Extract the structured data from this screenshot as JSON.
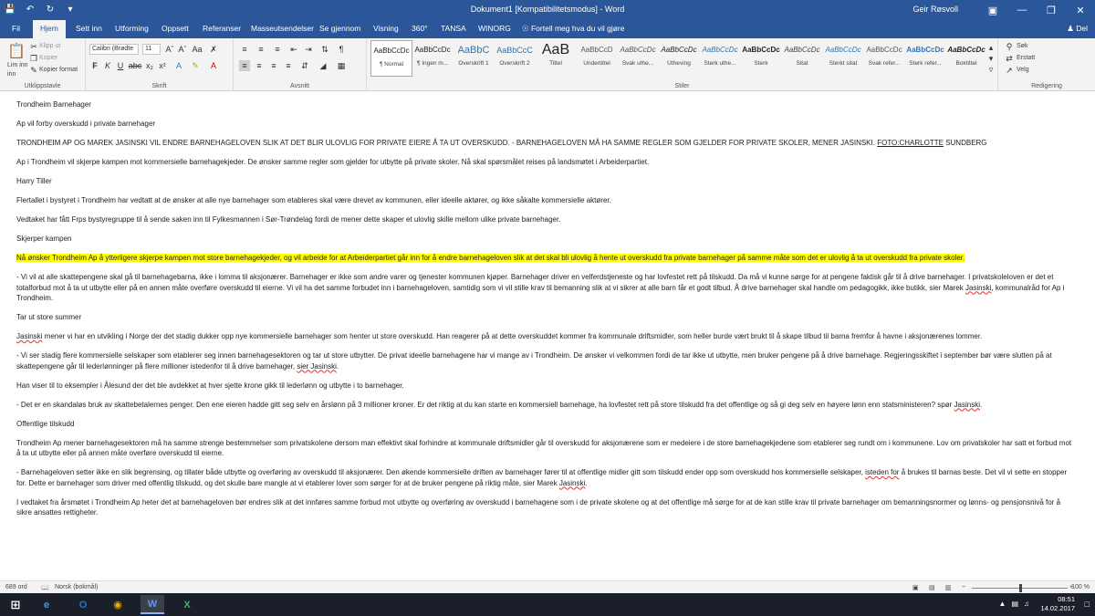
{
  "titlebar": {
    "doc_title": "Dokument1 [Kompatibilitetsmodus] - Word",
    "user": "Geir Røsvoll"
  },
  "tabs": {
    "file": "Fil",
    "home": "Hjem",
    "insert": "Sett inn",
    "design": "Utforming",
    "layout": "Oppsett",
    "references": "Referanser",
    "mailings": "Masseutsendelser",
    "review": "Se gjennom",
    "view": "Visning",
    "t360": "360°",
    "tansa": "TANSA",
    "winorg": "WINORG",
    "tellme": "Fortell meg hva du vil gjøre",
    "share": "Del"
  },
  "ribbon": {
    "clipboard": {
      "paste": "Lim inn",
      "cut": "Klipp ut",
      "copy": "Kopier",
      "format_painter": "Kopier format",
      "label": "Utklippstavle"
    },
    "font": {
      "name": "Calibri (Brødte",
      "size": "11",
      "label": "Skrift"
    },
    "paragraph": {
      "label": "Avsnitt"
    },
    "styles": {
      "label": "Stiler",
      "items": [
        {
          "sample": "AaBbCcDc",
          "name": "¶ Normal"
        },
        {
          "sample": "AaBbCcDc",
          "name": "¶ Ingen m..."
        },
        {
          "sample": "AaBbC",
          "name": "Overskrift 1"
        },
        {
          "sample": "AaBbCcC",
          "name": "Overskrift 2"
        },
        {
          "sample": "AaB",
          "name": "Tittel"
        },
        {
          "sample": "AaBbCcD",
          "name": "Undertittel"
        },
        {
          "sample": "AaBbCcDc",
          "name": "Svak uthe..."
        },
        {
          "sample": "AaBbCcDc",
          "name": "Utheving"
        },
        {
          "sample": "AaBbCcDc",
          "name": "Sterk uthe..."
        },
        {
          "sample": "AaBbCcDc",
          "name": "Sterk"
        },
        {
          "sample": "AaBbCcDc",
          "name": "Sitat"
        },
        {
          "sample": "AaBbCcDc",
          "name": "Sterkt sitat"
        },
        {
          "sample": "AaBbCcDc",
          "name": "Svak refer..."
        },
        {
          "sample": "AaBbCcDc",
          "name": "Sterk refer..."
        },
        {
          "sample": "AaBbCcDc",
          "name": "Boktittel"
        }
      ]
    },
    "editing": {
      "find": "Søk",
      "replace": "Erstatt",
      "select": "Velg",
      "label": "Redigering"
    }
  },
  "document": {
    "p1": "Trondheim Barnehager",
    "p2": "Ap vil forby overskudd i private barnehager",
    "p3a": "TRONDHEIM AP OG MAREK JASINSKI VIL ENDRE BARNEHAGELOVEN SLIK AT DET BLIR ULOVLIG FOR PRIVATE EIERE Å TA UT OVERSKUDD. - BARNEHAGELOVEN MÅ HA SAMME REGLER SOM GJELDER FOR PRIVATE SKOLER, MENER JASINSKI.",
    "p3b": "FOTO:CHARLOTTE",
    "p3c": "SUNDBERG",
    "p4": "Ap i Trondheim vil skjerpe kampen mot kommersielle barnehagekjeder. De ønsker samme regler som gjelder for utbytte på private skoler. Nå skal spørsmålet reises på landsmøtet i Arbeiderpartiet.",
    "p5": "Harry Tiller",
    "p6": "Flertallet i bystyret i Trondheim har vedtatt at de ønsker at alle  nye barnehager som etableres skal være drevet av kommunen, eller ideelle aktører, og ikke såkalte kommersielle aktører.",
    "p7": "Vedtaket har fått Frps bystyregruppe til å sende saken inn til Fylkesmannen i Sør-Trøndelag fordi de mener dette skaper et ulovlig skille mellom ulike private barnehager.",
    "p8": "Skjerper kampen",
    "p9": "Nå ønsker Trondheim Ap å ytterligere skjerpe kampen mot store barnehagekjeder, og vil arbeide for at Arbeiderpartiet går inn for å endre barnehageloven slik at det skal bli ulovlig å hente ut overskudd fra private barnehager på samme måte som det er ulovlig å ta ut overskudd fra private skoler.",
    "p10a": "- Vi vil at alle skattepengene skal gå til barnehagebarna, ikke i lomma til  aksjonærer. Barnehager er ikke som andre varer og tjenester kommunen kjøper. Barnehager driver en velferdstjeneste og har lovfestet rett på tilskudd. Da må vi kunne sørge for at  pengene faktisk går til å drive barnehager. I privatskoleloven er det et totalforbud mot å ta ut utbytte eller på en annen måte overføre overskudd til eierne. Vi vil ha det samme forbudet inn i barnehageloven, samtidig som vi vil stille krav til bemanning slik at vi sikrer at alle barn får et godt tilbud. Å drive barnehager skal handle om pedagogikk, ikke butikk, sier Marek",
    "p10b": "Jasinski",
    "p10c": ", kommunalråd for Ap i Trondheim.",
    "p11": "Tar ut store summer",
    "p12a": "Jasinski",
    "p12b": " mener vi har en utvikling i  Norge der det stadig dukker opp nye kommersielle barnehager som henter ut store overskudd. Han reagerer på at  dette overskuddet kommer fra kommunale driftsmidler, som heller burde vært brukt til å skape tilbud til barna fremfor å havne i aksjonærenes lommer.",
    "p13a": "- Vi ser stadig flere kommersielle selskaper som etablerer seg innen barnehagesektoren og tar ut store utbytter. De privat ideelle barnehagene har vi mange av i Trondheim. De ønsker vi velkommen fordi de tar ikke ut utbytte, men bruker pengene på å drive barnehage. Regjeringsskiftet i september bør være slutten på at skattepengene går til lederlønninger på flere millioner istedenfor til å drive barnehager,",
    "p13b": "sier Jasinski",
    "p13c": ".",
    "p14": "Han viser til to eksempler i Ålesund der det ble avdekket at hver sjette krone gikk til  lederlønn og utbytte i  to barnehager.",
    "p15a": "- Det er en skandaløs bruk av skattebetalernes penger. Den ene eieren hadde gitt seg selv en årslønn på 3 millioner  kroner. Er det riktig at du kan starte en kommersiell barnehage, ha lovfestet rett på store tilskudd fra det offentlige og så gi deg selv en høyere lønn enn statsministeren? spør",
    "p15b": "Jasinski",
    "p15c": ".",
    "p16": "Offentlige tilskudd",
    "p17": "Trondheim Ap mener barnehagesektoren må ha samme strenge bestemmelser som privatskolene dersom man effektivt skal forhindre at kommunale driftsmidler går til overskudd for aksjonærene som er medeiere i de store barnehagekjedene som etablerer seg rundt om i kommunene. Lov om privatskoler har satt et forbud mot å ta ut utbytte eller på  annen måte overføre overskudd til eierne.",
    "p18a": "- Barnehageloven setter ikke en slik begrensing, og tillater  både utbytte og overføring av overskudd til aksjonærer. Den økende kommersielle driften av barnehager fører til at offentlige midler gitt  som tilskudd ender opp som overskudd hos kommersielle selskaper,",
    "p18b": "isteden for",
    "p18c": " å brukes til barnas beste. Det vil vi sette en stopper for. Dette er barnehager som driver med offentlig tilskudd, og det skulle bare mangle at vi etablerer lover som sørger for at de bruker pengene på riktig måte, sier Marek",
    "p18d": "Jasinski",
    "p18e": ".",
    "p19": "I vedtaket fra årsmøtet i Trondheim Ap heter det at barnehageloven bør endres slik at det innføres samme forbud mot utbytte og overføring av overskudd i barnehagene som i de private skolene og at det offentlige må sørge for at de kan stille  krav til private barnehager om bemanningsnormer og lønns- og pensjonsnivå for å sikre ansattes rettigheter."
  },
  "statusbar": {
    "words": "689 ord",
    "language": "Norsk (bokmål)",
    "zoom": "100 %",
    "zoom_level": 1.0
  },
  "taskbar": {
    "time": "08:51",
    "date": "14.02.2017"
  },
  "colors": {
    "word_blue": "#2b579a",
    "highlight": "#ffff00"
  }
}
